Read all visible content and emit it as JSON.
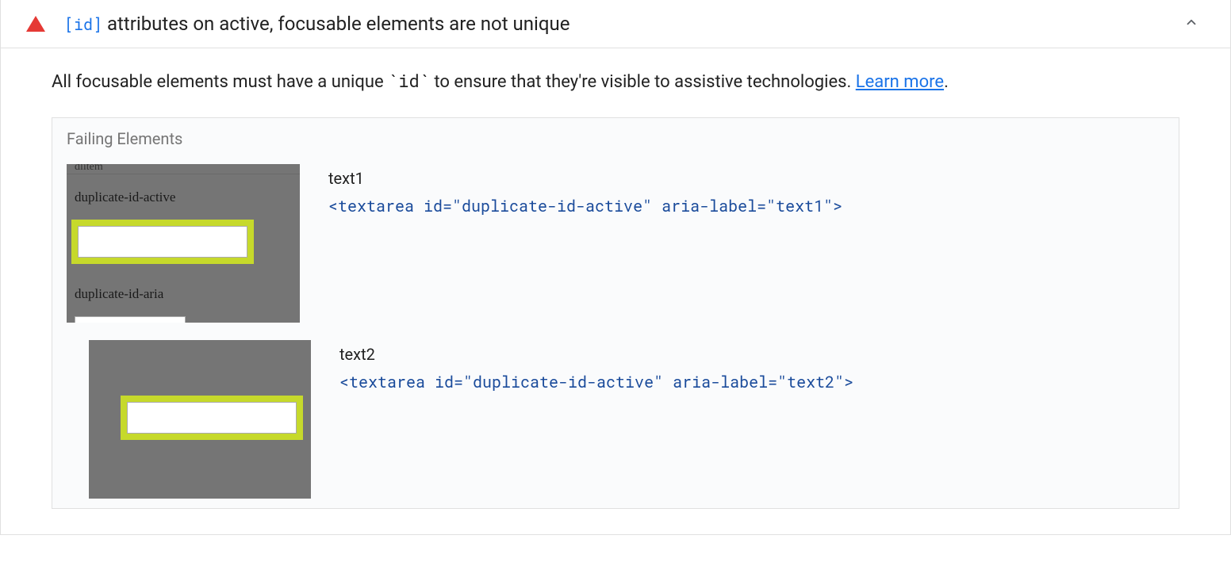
{
  "audit": {
    "title_code": "[id]",
    "title_suffix": " attributes on active, focusable elements are not unique",
    "description_prefix": "All focusable elements must have a unique ",
    "description_code": "`id`",
    "description_suffix": " to ensure that they're visible to assistive technologies. ",
    "learn_more": "Learn more",
    "period": "."
  },
  "failing": {
    "header": "Failing Elements",
    "items": [
      {
        "label": "text1",
        "code": "<textarea id=\"duplicate-id-active\" aria-label=\"text1\">",
        "thumb": {
          "cutTop": "dlitem",
          "label1": "duplicate-id-active",
          "label2": "duplicate-id-aria"
        }
      },
      {
        "label": "text2",
        "code": "<textarea id=\"duplicate-id-active\" aria-label=\"text2\">"
      }
    ]
  }
}
